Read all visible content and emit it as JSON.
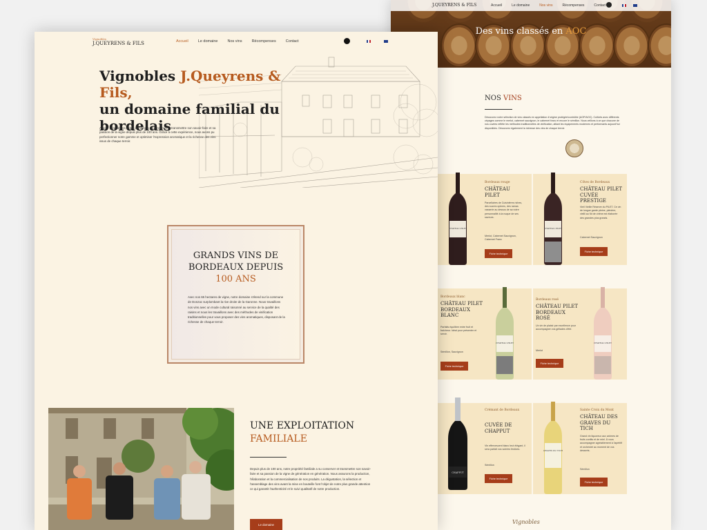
{
  "right_page": {
    "nav": {
      "logo": "J.QUEYRENS & FILS",
      "menu": [
        "Accueil",
        "Le domaine",
        "Nos vins",
        "Récompenses",
        "Contact"
      ]
    },
    "hero": {
      "title_before": "Des vins classés en ",
      "title_accent": "AOC"
    },
    "section": {
      "title_before": "NOS ",
      "title_accent": "VINS",
      "description": "Découvrez notre sélection de vins classés en appellation d'origine protégée/contrôlée (AOP/AOC). Cultivés avec différents cépages comme le merlot, cabernet sauvignon, le cabernet franc et encore le sémillon. Nous veillons à ce que chacune de nos cuvées reflète les méthodes traditionnelles de vinification, alliant les équipements modernes et performants aujourd'hui disponibles. Découvrez également la richesse des vins de chaque terroir."
    },
    "wines": [
      {
        "subtitle": "Bordeaux rouge",
        "name": "CHÂTEAU PILET",
        "text": "Parcellaires de Cuisinières riches, des sucres opimes, des ramas vasserie au dessus de sa notre personnalité à la nuque de ses saveurs.",
        "grapes": "Merlot, Cabernet Sauvignon, Cabernet Franc",
        "button": "Fiche technique",
        "bottle_label": "CHATEAU PILET"
      },
      {
        "subtitle": "Côtes de Bordeaux",
        "name": "CHÂTEAU PILET CUVÉE PRESTIGE",
        "text": "Vieil Vieille Réserve du PILET. Ce vin de longue garde pleine, plénière, vieilli au fût de chêne est élaborée des grandes plus grands.",
        "grapes": "Cabernet Sauvignon",
        "button": "Fiche technique",
        "bottle_label": "CHATEAU PILET"
      },
      {
        "subtitle": "Bordeaux blanc",
        "name": "CHÂTEAU PILET BORDEAUX BLANC",
        "text": "Parfaits équilibre entre fruit et fraîcheur. Idéal pour présenter et servir.",
        "grapes": "Sémillon, Sauvignon",
        "button": "Fiche technique",
        "bottle_label": "CHATEAU PILET"
      },
      {
        "subtitle": "Bordeaux rosé",
        "name": "CHÂTEAU PILET BORDEAUX ROSÉ",
        "text": "Un vin de plaisir par excellence pour accompagner vos grillades d'été.",
        "grapes": "Merlot",
        "button": "Fiche technique",
        "bottle_label": "CHATEAU PILET"
      },
      {
        "subtitle": "Crémant de Bordeaux",
        "name": "CUVÉE DE CHAPPUT",
        "text": "Vin effervescent blanc brut élégant, il sera parfait vos soirées festives.",
        "grapes": "Sémillon",
        "button": "Fiche technique",
        "bottle_label": "CHAPPUT"
      },
      {
        "subtitle": "Sainte Croix du Mont",
        "name": "CHÂTEAU DES GRAVES DU TICH",
        "text": "Grand vin liquoreux aux arômes de fruits confits et de miel. À vous accompagner agréablement à l'apéritif et orchestré au moment de vos desserts.",
        "grapes": "Sémillon",
        "button": "Fiche technique",
        "bottle_label": "GRAVES DU TICH"
      }
    ],
    "footer_script": "Vignobles"
  },
  "left_page": {
    "nav": {
      "logo_small": "Vignobles",
      "logo": "J.QUEYRENS & FILS",
      "menu": [
        "Accueil",
        "Le domaine",
        "Nos vins",
        "Récompenses",
        "Contact"
      ]
    },
    "hero": {
      "title_line1_before": "Vignobles ",
      "title_line1_accent": "J.Queyrens & Fils,",
      "title_rest": "un domaine familial du bordelais",
      "intro": "Avec 7 générations, notre domaine a su conserver et transmettre son savoir-faire et sa passion de la vigne depuis plus de 100 ans. Grâce à cette expérience, nous avons pu perfectionner notre gamme et optimiser l'expression aromatique et la richesse des vins issus de chaque terroir."
    },
    "box": {
      "title_line1": "GRANDS VINS DE",
      "title_line2": "BORDEAUX DEPUIS",
      "title_accent": "100 ANS",
      "text": "Avec nos 65 hectares de vigne, notre domaine s'étend sur la commune de Donzac surplombant la rive droite de la Garonne. Nous travaillons nos vins avec un mode cultural raisonné au service de la qualité des raisins et nous les travaillons avec des méthodes de vinification traditionnelles pour vous proposer des vins aromatiques, disposant de la richesse de chaque terroir."
    },
    "exploitation": {
      "title_line1": "UNE EXPLOITATION",
      "title_accent": "FAMILIALE",
      "text": "Depuis plus de 100 ans, notre propriété familiale a su conserver et transmettre son savoir-faire et sa passion de la vigne de génération en génération. Nous assurons la production, l'élaboration et la commercialisation de nos produits. La dégustation, la sélection et l'assemblage des vins avant la mise en bouteille font l'objet de notre plus grande attention ce qui garantit l'authenticité et le suivi qualitatif de notre production.",
      "button": "Le domaine"
    }
  },
  "colors": {
    "accent": "#b65a1e",
    "button": "#a63d1a",
    "card": "#f6e6c4",
    "page": "#fbf3e3"
  }
}
